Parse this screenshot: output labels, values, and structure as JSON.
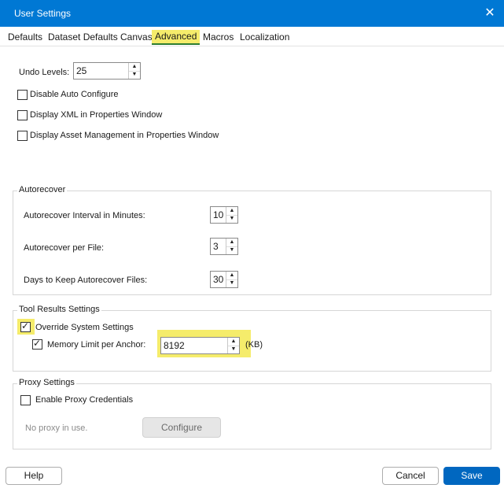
{
  "window": {
    "title": "User Settings",
    "close_glyph": "✕"
  },
  "tabs": [
    {
      "label": "Defaults"
    },
    {
      "label": "Dataset Defaults"
    },
    {
      "label": "Canvas"
    },
    {
      "label": "Advanced"
    },
    {
      "label": "Macros"
    },
    {
      "label": "Localization"
    }
  ],
  "general": {
    "undo_label": "Undo Levels:",
    "undo_value": "25",
    "disable_auto_configure": "Disable Auto Configure",
    "display_xml": "Display XML in Properties Window",
    "display_asset": "Display Asset Management in Properties Window"
  },
  "autorecover": {
    "title": "Autorecover",
    "interval_label": "Autorecover Interval in Minutes:",
    "interval_value": "10",
    "per_file_label": "Autorecover per File:",
    "per_file_value": "3",
    "days_label": "Days to Keep Autorecover Files:",
    "days_value": "30"
  },
  "tool_results": {
    "title": "Tool Results Settings",
    "override_label": "Override System Settings",
    "override_checked": true,
    "memory_label": "Memory Limit per Anchor:",
    "memory_checked": true,
    "memory_value": "8192",
    "memory_unit": "(KB)"
  },
  "proxy": {
    "title": "Proxy Settings",
    "enable_label": "Enable Proxy Credentials",
    "status": "No proxy in use.",
    "configure_label": "Configure"
  },
  "footer": {
    "help_label": "Help",
    "cancel_label": "Cancel",
    "save_label": "Save"
  },
  "colors": {
    "titlebar": "#0078d4",
    "highlight": "#f5ec6b",
    "primary": "#0067c0",
    "tab_underline": "#2e7d32"
  },
  "icons": {
    "spin_up": "up-arrow-icon",
    "spin_down": "down-arrow-icon",
    "close": "close-icon"
  }
}
